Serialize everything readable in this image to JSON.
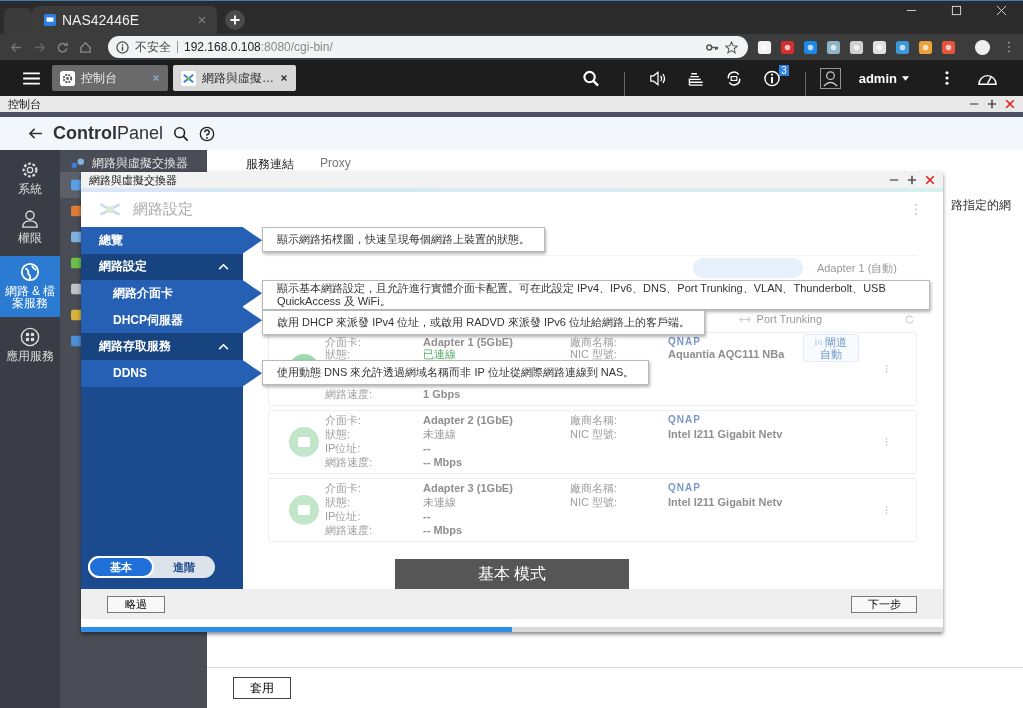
{
  "browser": {
    "tab_title": "NAS42446E",
    "url_warning": "不安全",
    "url_host": "192.168.0.108",
    "url_path": ":8080/cgi-bin/"
  },
  "topbar": {
    "app_tabs": [
      {
        "label": "控制台",
        "kind": "settings",
        "selected": false
      },
      {
        "label": "網路與虛擬…",
        "kind": "network",
        "selected": true
      }
    ],
    "notification_count": "3",
    "user": "admin"
  },
  "window": {
    "title": "控制台"
  },
  "header": {
    "title": "**Control**Panel"
  },
  "sidebar": {
    "items": [
      {
        "label": "系統",
        "kind": "settings",
        "selected": false
      },
      {
        "label": "權限",
        "kind": "user",
        "selected": false
      },
      {
        "label": "網路 & 檔案服務",
        "kind": "globe",
        "selected": true
      },
      {
        "label": "應用服務",
        "kind": "apps",
        "selected": false
      }
    ]
  },
  "submenu": {
    "title": "網路與虛擬交換器",
    "items": [
      {
        "selected": true
      },
      {
        "selected": false
      },
      {
        "selected": false
      },
      {
        "selected": false
      },
      {
        "selected": false
      },
      {
        "selected": false
      },
      {
        "selected": false
      }
    ]
  },
  "main": {
    "tabs": [
      {
        "label": "服務連結",
        "selected": true
      },
      {
        "label": "Proxy",
        "selected": false
      }
    ],
    "note": "路指定的網",
    "apply_button": "套用"
  },
  "wizard": {
    "title": "網路與虛擬交換器",
    "heading": "網路設定",
    "nav": [
      {
        "label": "總覽",
        "kind": "link",
        "highlighted": true,
        "hint": "顯示網路拓樸圖，快速呈現每個網路上裝置的狀態。"
      },
      {
        "label": "網路設定",
        "kind": "section",
        "expanded": true,
        "highlighted": false
      },
      {
        "label": "網路介面卡",
        "kind": "subitem",
        "highlighted": true,
        "hint": "顯示基本網路設定，且允許進行實體介面卡配置。可在此設定 IPv4、IPv6、DNS、Port Trunking、VLAN、Thunderbolt、USB QuickAccess 及 WiFi。"
      },
      {
        "label": "DHCP伺服器",
        "kind": "subitem",
        "highlighted": true,
        "hint": "啟用 DHCP 來派發 IPv4 位址，或啟用 RADVD 來派發 IPv6 位址給網路上的客戶端。"
      },
      {
        "label": "網路存取服務",
        "kind": "section",
        "expanded": true,
        "highlighted": false
      },
      {
        "label": "DDNS",
        "kind": "subitem",
        "highlighted": true,
        "hint": "使用動態 DNS 來允許透過網域名稱而非 IP 位址從網際網路連線到 NAS。"
      }
    ],
    "modes": [
      {
        "label": "基本",
        "selected": true
      },
      {
        "label": "進階",
        "selected": false
      }
    ],
    "adapter_selector": "Adapter 1 (自動)",
    "port_trunking": "Port Trunking",
    "cards": [
      {
        "connected": true,
        "rows": [
          {
            "kind": "text",
            "label": "介面卡:",
            "value": "Adapter 1 (5GbE)"
          },
          {
            "kind": "status",
            "label": "狀態:",
            "value": "已連線"
          },
          {
            "kind": "text",
            "label": "網路速度:",
            "value": "1 Gbps"
          }
        ],
        "vendor_label": "廠商名稱:",
        "vendor": "QNAP",
        "model_label": "NIC 型號:",
        "model": "Aquantia AQC111 NBa",
        "gateway": {
          "label": "閘道",
          "value": "自動"
        }
      },
      {
        "connected": false,
        "rows": [
          {
            "kind": "text",
            "label": "介面卡:",
            "value": "Adapter 2 (1GbE)"
          },
          {
            "kind": "status",
            "label": "狀態:",
            "value": "未連線"
          },
          {
            "kind": "text",
            "label": "IP位址:",
            "value": "--"
          },
          {
            "kind": "text",
            "label": "網路速度:",
            "value": "-- Mbps"
          }
        ],
        "vendor_label": "廠商名稱:",
        "vendor": "QNAP",
        "model_label": "NIC 型號:",
        "model": "Intel I211 Gigabit Netv"
      },
      {
        "connected": false,
        "rows": [
          {
            "kind": "text",
            "label": "介面卡:",
            "value": "Adapter 3 (1GbE)"
          },
          {
            "kind": "status",
            "label": "狀態:",
            "value": "未連線"
          },
          {
            "kind": "text",
            "label": "IP位址:",
            "value": "--"
          },
          {
            "kind": "text",
            "label": "網路速度:",
            "value": "-- Mbps"
          }
        ],
        "vendor_label": "廠商名稱:",
        "vendor": "QNAP",
        "model_label": "NIC 型號:",
        "model": "Intel I211 Gigabit Netv"
      }
    ],
    "mode_banner": "基本 模式",
    "skip_button": "略過",
    "next_button": "下一步",
    "progress": {
      "level": 0.5
    }
  }
}
